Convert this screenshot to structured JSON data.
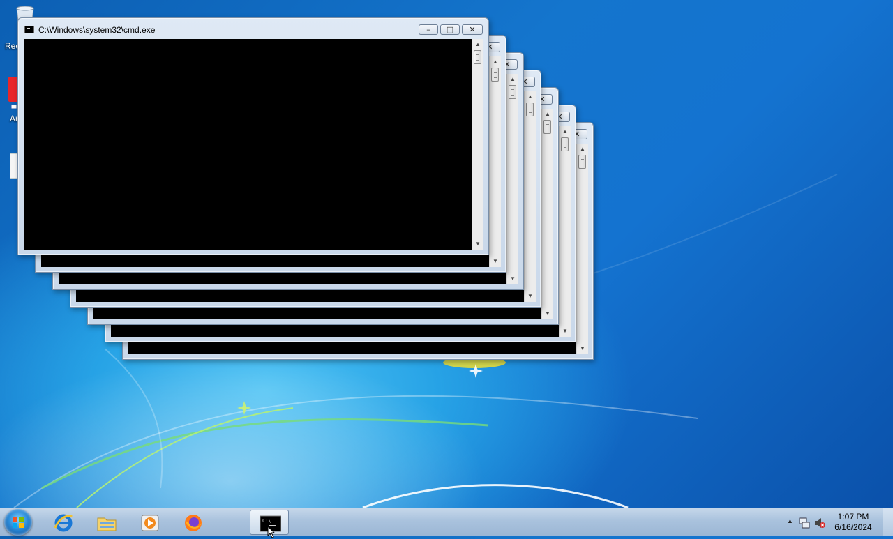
{
  "desktop": {
    "icons": [
      {
        "label": "Rec",
        "icon": "recycle-bin-icon"
      },
      {
        "label": "Ar",
        "icon": "app-shortcut-icon"
      },
      {
        "label": "",
        "icon": "document-icon"
      }
    ]
  },
  "windows": [
    {
      "title": "C:\\Windows\\system32\\cmd.exe",
      "minimize": "–",
      "maximize": "□",
      "close": "✕"
    },
    {
      "title": "",
      "minimize": "–",
      "maximize": "□",
      "close": "✕"
    },
    {
      "title": "",
      "minimize": "–",
      "maximize": "□",
      "close": "✕"
    },
    {
      "title": "",
      "minimize": "–",
      "maximize": "□",
      "close": "✕"
    },
    {
      "title": "",
      "minimize": "–",
      "maximize": "□",
      "close": "✕"
    },
    {
      "title": "",
      "minimize": "–",
      "maximize": "□",
      "close": "✕"
    },
    {
      "title": "",
      "minimize": "–",
      "maximize": "□",
      "close": "✕"
    }
  ],
  "taskbar": {
    "start": "start-orb-icon",
    "pinned": [
      {
        "name": "internet-explorer",
        "icon": "internet-explorer-icon"
      },
      {
        "name": "windows-explorer",
        "icon": "folder-icon"
      },
      {
        "name": "media-player",
        "icon": "media-player-icon"
      },
      {
        "name": "firefox",
        "icon": "firefox-icon"
      },
      {
        "name": "command-prompt",
        "icon": "cmd-icon",
        "active": true
      }
    ],
    "tray": {
      "show_hidden": "▲",
      "network": "network-icon",
      "volume": "volume-muted-icon",
      "time": "1:07 PM",
      "date": "6/16/2024"
    }
  }
}
